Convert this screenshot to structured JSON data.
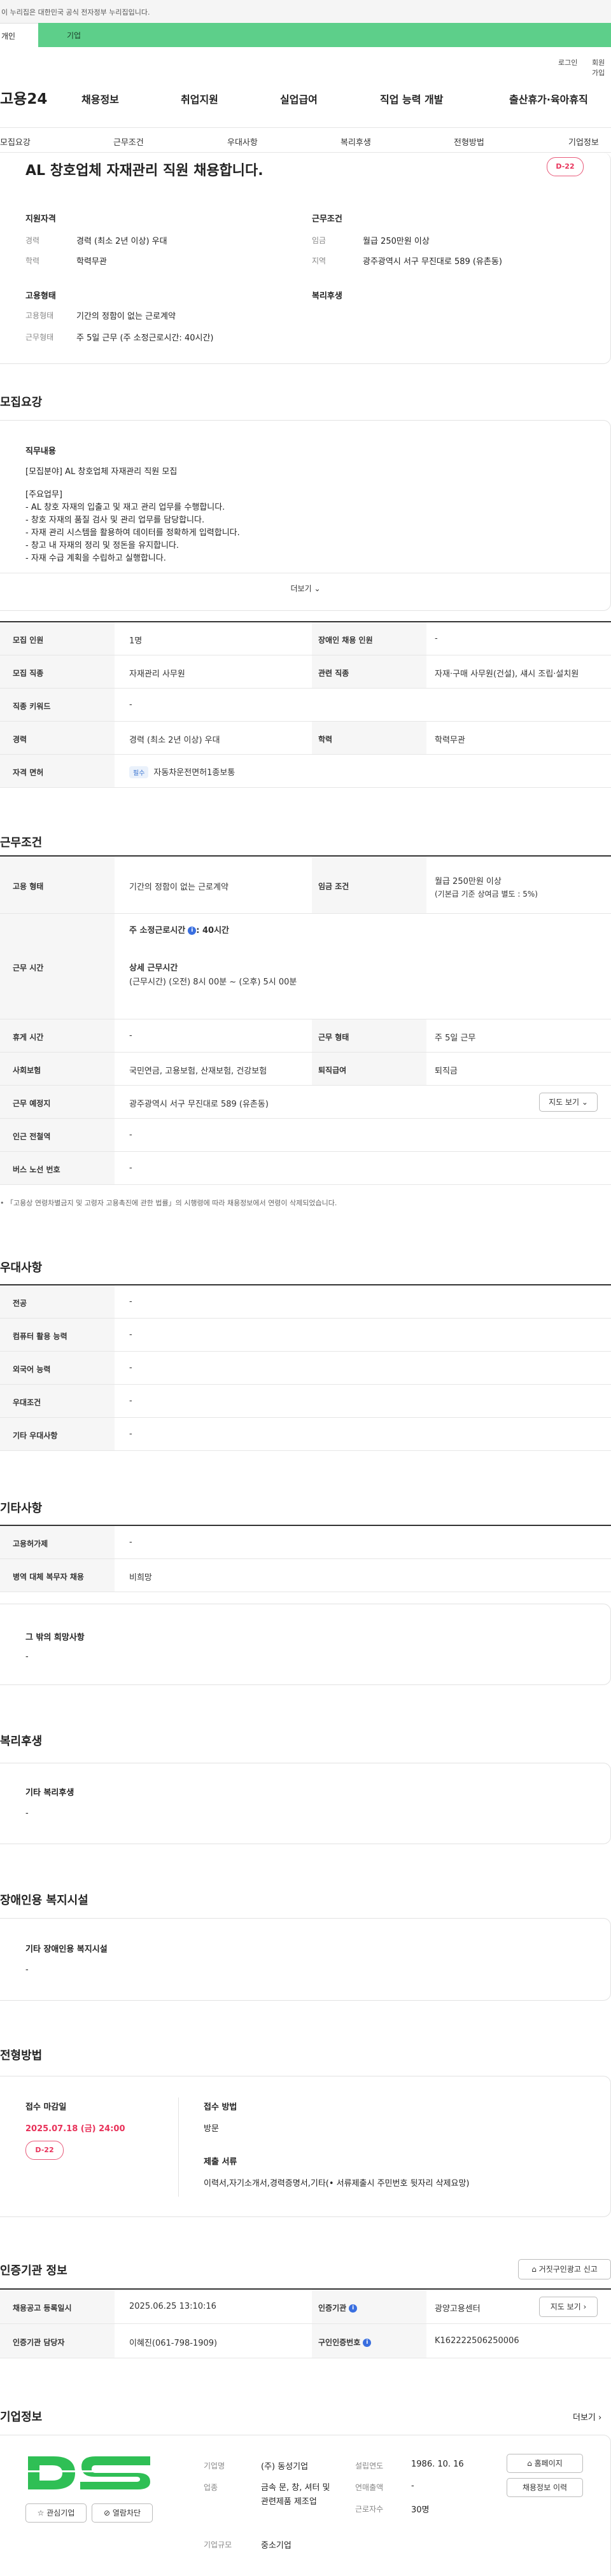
{
  "gov_bar": {
    "text": "이 누리집은 대한민국 공식 전자정부 누리집입니다."
  },
  "tabs": {
    "person": "개인",
    "company": "기업"
  },
  "util": {
    "login": "로그인",
    "join": "회원가입"
  },
  "logo": "고용24",
  "gnb": [
    "채용정보",
    "취업지원",
    "실업급여",
    "직업 능력 개발",
    "출산휴가·육아휴직"
  ],
  "subnav": [
    "모집요강",
    "근무조건",
    "우대사항",
    "복리후생",
    "전형방법",
    "기업정보"
  ],
  "header": {
    "title": "AL 창호업체 자재관리 직원 채용합니다.",
    "dday": "D-22",
    "qual_title": "지원자격",
    "cond_title": "근무조건",
    "type_title": "고용형태",
    "welfare_title": "복리후생",
    "career_label": "경력",
    "career": "경력 (최소 2년 이상) 우대",
    "edu_label": "학력",
    "edu": "학력무관",
    "wage_label": "임금",
    "wage": "월급 250만원 이상",
    "region_label": "지역",
    "region": "광주광역시 서구 무진대로 589 (유촌동)",
    "emp_label": "고용형태",
    "emp": "기간의 정함이 없는 근로계약",
    "work_label": "근무형태",
    "work": "주 5일 근무 (주 소정근로시간: 40시간)"
  },
  "recruit": {
    "title": "모집요강",
    "duty_title": "직무내용",
    "lines": [
      "[모집분야] AL 창호업체 자재관리 직원 모집",
      "",
      "[주요업무]",
      "- AL 창호 자재의 입출고 및 재고 관리 업무를 수행합니다.",
      "- 창호 자재의 품질 검사 및 관리 업무를 담당합니다.",
      "- 자재 관리 시스템을 활용하여 데이터를 정확하게 입력합니다.",
      "- 창고 내 자재의 정리 및 정돈을 유지합니다.",
      "- 자재 수급 계획을 수립하고 실행합니다."
    ],
    "more": "더보기",
    "count_label": "모집 인원",
    "count": "1명",
    "disabled_label": "장애인 채용 인원",
    "disabled": "-",
    "job_label": "모집 직종",
    "job": "자재관리 사무원",
    "rel_label": "관련 직종",
    "rel": "자재·구매 사무원(건설), 섀시 조립·설치원",
    "kw_label": "직종 키워드",
    "kw": "-",
    "career_label": "경력",
    "career": "경력 (최소 2년 이상) 우대",
    "edu_label": "학력",
    "edu": "학력무관",
    "lic_label": "자격 면허",
    "lic_chip": "필수",
    "lic": "자동차운전면허1종보통"
  },
  "cond": {
    "title": "근무조건",
    "emp_label": "고용 형태",
    "emp": "기간의 정함이 없는 근로계약",
    "wage_label": "임금 조건",
    "wage1": "월급 250만원 이상",
    "wage2": "(기본급 기준 상여금 별도 : 5%)",
    "time_label": "근무 시간",
    "time_weekly": "주 소정근로시간",
    "time_weekly_val": ": 40시간",
    "time_detail_title": "상세 근무시간",
    "time_detail": "(근무시간) (오전) 8시 00분 ~ (오후) 5시 00분",
    "rest_label": "휴게 시간",
    "rest": "-",
    "form_label": "근무 형태",
    "form": "주 5일 근무",
    "ins_label": "사회보험",
    "ins": "국민연금, 고용보험, 산재보험, 건강보험",
    "retire_label": "퇴직급여",
    "retire": "퇴직금",
    "place_label": "근무 예정지",
    "place": "광주광역시 서구 무진대로 589 (유촌동)",
    "map_btn": "지도 보기",
    "subway_label": "인근 전철역",
    "subway": "-",
    "bus_label": "버스 노선 번호",
    "bus": "-",
    "note": "「고용상 연령차별금지 및 고령자 고용촉진에 관한 법률」의 시행령에 따라 채용정보에서 연령이 삭제되었습니다."
  },
  "pref": {
    "title": "우대사항",
    "rows": [
      {
        "k": "전공",
        "v": "-"
      },
      {
        "k": "컴퓨터 활용 능력",
        "v": "-"
      },
      {
        "k": "외국어 능력",
        "v": "-"
      },
      {
        "k": "우대조건",
        "v": "-"
      },
      {
        "k": "기타 우대사항",
        "v": "-"
      }
    ]
  },
  "etc": {
    "title": "기타사항",
    "rows": [
      {
        "k": "고용허가제",
        "v": "-"
      },
      {
        "k": "병역 대체 복무자 채용",
        "v": "비희망"
      }
    ],
    "box_title": "그 밖의 희망사항",
    "box_val": "-"
  },
  "welfare": {
    "title": "복리후생",
    "box_title": "기타 복리후생",
    "box_val": "-"
  },
  "disab": {
    "title": "장애인용 복지시설",
    "box_title": "기타 장애인용 복지시설",
    "box_val": "-"
  },
  "screen": {
    "title": "전형방법",
    "deadline_title": "접수 마감일",
    "deadline": "2025.07.18 (금) 24:00",
    "dday": "D-22",
    "method_title": "접수 방법",
    "method": "방문",
    "docs_title": "제출 서류",
    "docs": "이력서,자기소개서,경력증명서,기타(• 서류제출시 주민번호 뒷자리 삭제요망)"
  },
  "cert": {
    "title": "인증기관 정보",
    "report_btn": "거짓구인광고 신고",
    "reg_label": "채용공고 등록일시",
    "reg": "2025.06.25 13:10:16",
    "org_label": "인증기관",
    "org": "광양고용센터",
    "map_btn": "지도 보기",
    "mgr_label": "인증기관 담당자",
    "mgr": "이혜진(061-798-1909)",
    "no_label": "구인인증번호",
    "no": "K162222506250006"
  },
  "company": {
    "title": "기업정보",
    "more": "더보기",
    "fav": "관심기업",
    "block": "열람차단",
    "name_label": "기업명",
    "name": "(주) 동성기업",
    "ind_label": "업종",
    "ind": "금속 문, 창, 셔터 및 관련제품 제조업",
    "size_label": "기업규모",
    "size": "중소기업",
    "found_label": "설립연도",
    "found": "1986. 10. 16",
    "sales_label": "연매출액",
    "sales": "-",
    "emp_label": "근로자수",
    "emp": "30명",
    "home_btn": "홈페이지",
    "jobs_btn": "채용정보 이력"
  },
  "colors": {
    "accent_green": "#5dcf8a",
    "dday_red": "#e8325a",
    "link_blue": "#3a6fe0"
  }
}
